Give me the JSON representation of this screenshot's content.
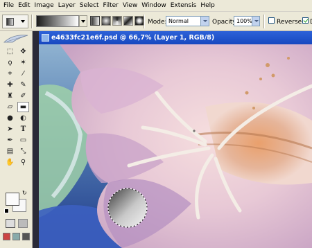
{
  "menubar": {
    "items": [
      "File",
      "Edit",
      "Image",
      "Layer",
      "Select",
      "Filter",
      "View",
      "Window",
      "Extensis",
      "Help"
    ]
  },
  "options": {
    "mode_label": "Mode:",
    "mode_value": "Normal",
    "opacity_label": "Opacity:",
    "opacity_value": "100%",
    "reverse_label": "Reverse",
    "reverse_checked": false,
    "dither_label": "Di",
    "dither_checked": true
  },
  "document": {
    "title": "e4633fc21e6f.psd @ 66,7% (Layer 1, RGB/8)"
  },
  "toolbox": {
    "tools": [
      "marquee-icon",
      "move-icon",
      "lasso-icon",
      "magic-wand-icon",
      "crop-icon",
      "slice-icon",
      "healing-brush-icon",
      "brush-icon",
      "clone-stamp-icon",
      "history-brush-icon",
      "eraser-icon",
      "gradient-icon",
      "blur-icon",
      "dodge-icon",
      "path-selection-icon",
      "type-icon",
      "pen-icon",
      "shape-icon",
      "notes-icon",
      "eyedropper-icon",
      "hand-icon",
      "zoom-icon"
    ]
  }
}
